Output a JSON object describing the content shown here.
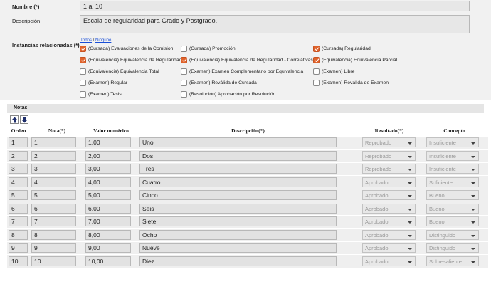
{
  "form": {
    "nombre_label": "Nombre (*)",
    "nombre_value": "1 al 10",
    "descripcion_label": "Descripción",
    "descripcion_value": "Escala de regularidad para Grado y Postgrado.",
    "instancias_label": "Instancias relacionadas (*)",
    "todos_label": "Todos",
    "separator": " / ",
    "ninguno_label": "Ninguno"
  },
  "instancias": [
    {
      "label": "(Cursada) Evaluaciones de la Comision",
      "checked": true
    },
    {
      "label": "(Cursada) Promoción",
      "checked": false
    },
    {
      "label": "(Cursada) Regularidad",
      "checked": true
    },
    {
      "label": "(Equivalencia) Equivalencia de Regularidad",
      "checked": true
    },
    {
      "label": "(Equivalencia) Equivalencia de Regularidad - Correlativas",
      "checked": true
    },
    {
      "label": "(Equivalencia) Equivalencia Parcial",
      "checked": true
    },
    {
      "label": "(Equivalencia) Equivalencia Total",
      "checked": false
    },
    {
      "label": "(Examen) Examen Complementario por Equivalencia",
      "checked": false
    },
    {
      "label": "(Examen) Libre",
      "checked": false
    },
    {
      "label": "(Examen) Regular",
      "checked": false
    },
    {
      "label": "(Examen) Reválida de Cursada",
      "checked": false
    },
    {
      "label": "(Examen) Reválida de Examen",
      "checked": false
    },
    {
      "label": "(Examen) Tesis",
      "checked": false
    },
    {
      "label": "(Resolución) Aprobación por Resolución",
      "checked": false
    }
  ],
  "notas": {
    "title": "Notas",
    "move_up_icon": "arrow-up-icon",
    "move_down_icon": "arrow-down-icon",
    "columns": [
      "Orden",
      "Nota(*)",
      "Valor numérico",
      "Descripción(*)",
      "Resultado(*)",
      "Concepto"
    ],
    "rows": [
      {
        "orden": "1",
        "nota": "1",
        "valor": "1,00",
        "descripcion": "Uno",
        "resultado": "Reprobado",
        "concepto": "Insuficiente"
      },
      {
        "orden": "2",
        "nota": "2",
        "valor": "2,00",
        "descripcion": "Dos",
        "resultado": "Reprobado",
        "concepto": "Insuficiente"
      },
      {
        "orden": "3",
        "nota": "3",
        "valor": "3,00",
        "descripcion": "Tres",
        "resultado": "Reprobado",
        "concepto": "Insuficiente"
      },
      {
        "orden": "4",
        "nota": "4",
        "valor": "4,00",
        "descripcion": "Cuatro",
        "resultado": "Aprobado",
        "concepto": "Suficiente"
      },
      {
        "orden": "5",
        "nota": "5",
        "valor": "5,00",
        "descripcion": "Cinco",
        "resultado": "Aprobado",
        "concepto": "Bueno"
      },
      {
        "orden": "6",
        "nota": "6",
        "valor": "6,00",
        "descripcion": "Seis",
        "resultado": "Aprobado",
        "concepto": "Bueno"
      },
      {
        "orden": "7",
        "nota": "7",
        "valor": "7,00",
        "descripcion": "Siete",
        "resultado": "Aprobado",
        "concepto": "Bueno"
      },
      {
        "orden": "8",
        "nota": "8",
        "valor": "8,00",
        "descripcion": "Ocho",
        "resultado": "Aprobado",
        "concepto": "Distinguido"
      },
      {
        "orden": "9",
        "nota": "9",
        "valor": "9,00",
        "descripcion": "Nueve",
        "resultado": "Aprobado",
        "concepto": "Distinguido"
      },
      {
        "orden": "10",
        "nota": "10",
        "valor": "10,00",
        "descripcion": "Diez",
        "resultado": "Aprobado",
        "concepto": "Sobresaliente"
      }
    ]
  },
  "colors": {
    "checkbox_checked": "#e0632c",
    "link": "#1a4fd6"
  }
}
